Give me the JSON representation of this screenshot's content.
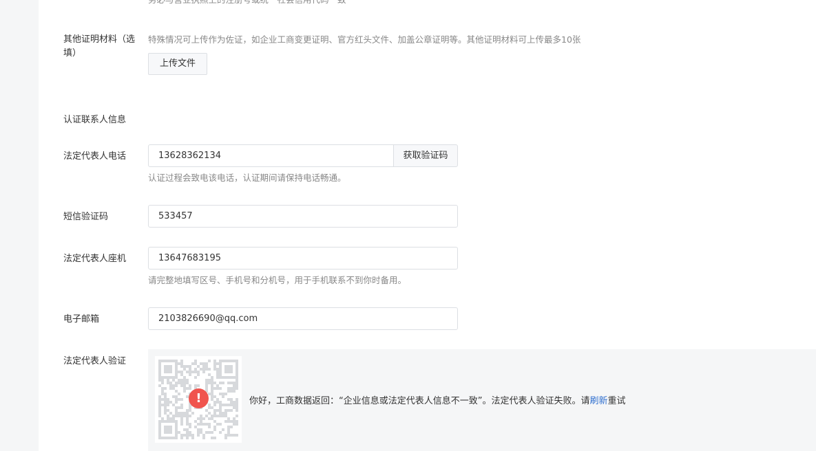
{
  "top_hint": "务必与营业执照上的注册号或统一社会信用代码一致",
  "other_materials": {
    "label_line1": "其他证明材料（选",
    "label_line2": "填）",
    "hint": "特殊情况可上传作为佐证，如企业工商变更证明、官方红头文件、加盖公章证明等。其他证明材料可上传最多10张",
    "upload_label": "上传文件"
  },
  "contact_section": {
    "title": "认证联系人信息"
  },
  "legal_phone": {
    "label": "法定代表人电话",
    "value": "13628362134",
    "get_code_label": "获取验证码",
    "hint": "认证过程会致电该电话，认证期间请保持电话畅通。"
  },
  "sms_code": {
    "label": "短信验证码",
    "value": "533457"
  },
  "landline": {
    "label": "法定代表人座机",
    "value": "13647683195",
    "hint": "请完整地填写区号、手机号和分机号，用于手机联系不到你时备用。"
  },
  "email": {
    "label": "电子邮箱",
    "value": "2103826690@qq.com"
  },
  "legal_verify": {
    "label": "法定代表人验证",
    "error_icon": "exclamation-icon",
    "message_prefix": "你好，工商数据返回：“企业信息或法定代表人信息不一致”。法定代表人验证失败。请",
    "refresh_link": "刷新",
    "message_suffix": "重试"
  },
  "colors": {
    "error": "#f0544e",
    "link": "#2f6fcf",
    "hint": "#888888"
  }
}
